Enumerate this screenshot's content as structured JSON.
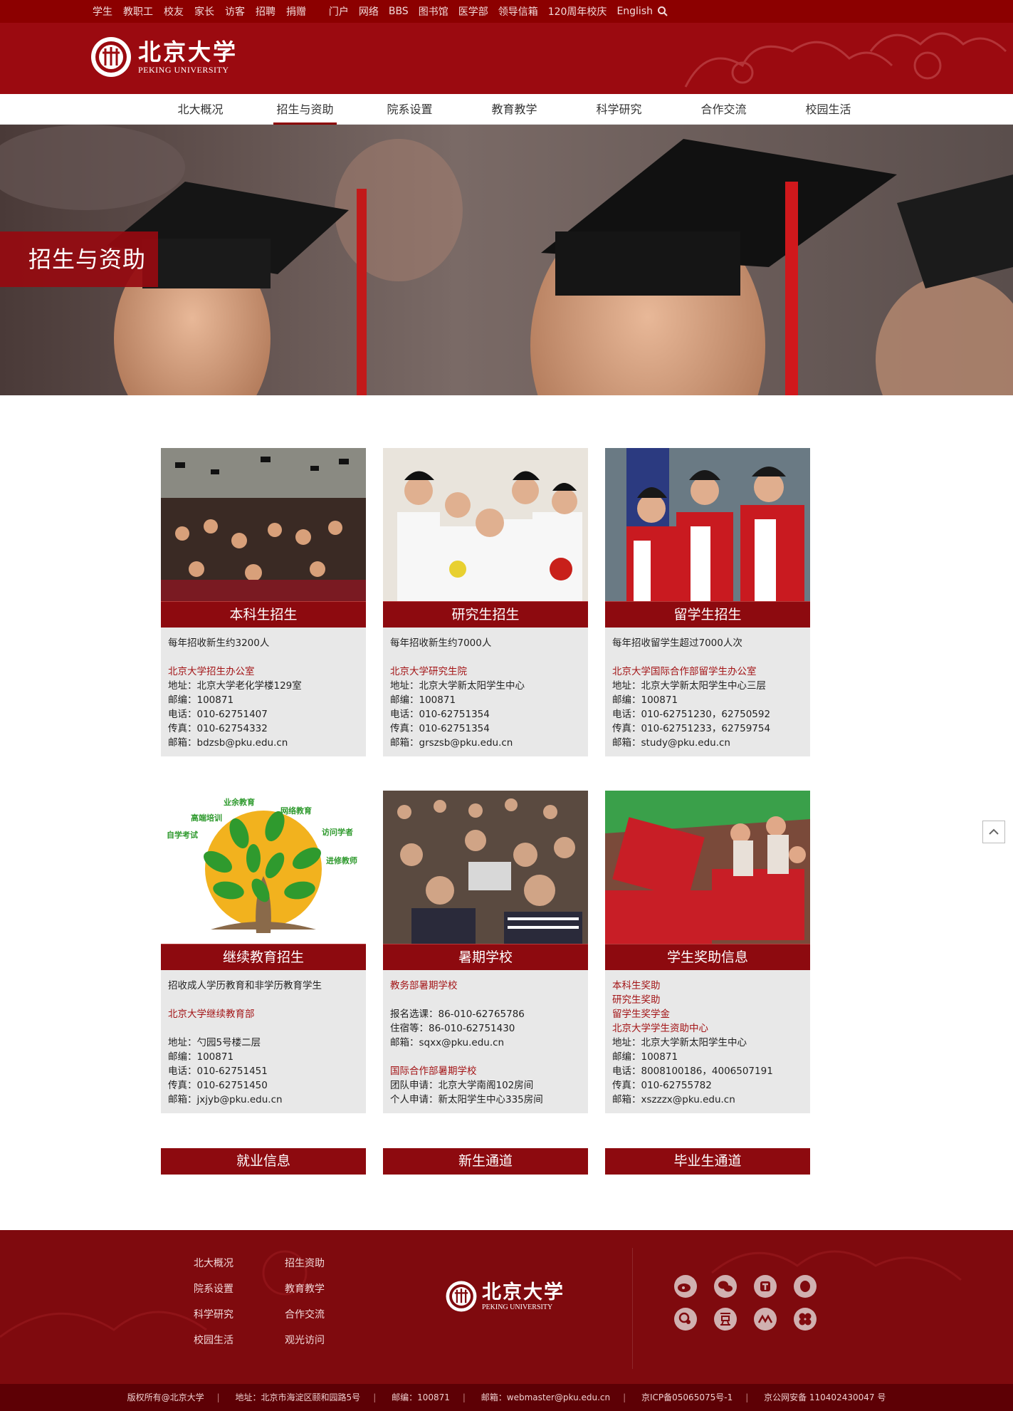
{
  "topbar": {
    "left_links": [
      "学生",
      "教职工",
      "校友",
      "家长",
      "访客",
      "招聘",
      "捐赠"
    ],
    "right_links": [
      "门户",
      "网络",
      "BBS",
      "图书馆",
      "医学部",
      "领导信箱",
      "120周年校庆",
      "English"
    ],
    "search_icon": "search-icon"
  },
  "header": {
    "logo_cn": "北京大学",
    "logo_en": "PEKING UNIVERSITY",
    "seal_icon": "pku-seal-icon"
  },
  "nav": {
    "items": [
      "北大概况",
      "招生与资助",
      "院系设置",
      "教育教学",
      "科学研究",
      "合作交流",
      "校园生活"
    ],
    "active": "招生与资助"
  },
  "banner": {
    "title": "招生与资助"
  },
  "cards": [
    {
      "title": "本科生招生",
      "summary": "每年招收新生约3200人",
      "office": "北京大学招生办公室",
      "address": "地址：北京大学老化学楼129室",
      "postcode": "邮编：100871",
      "phone": "电话：010-62751407",
      "fax": "传真：010-62754332",
      "email": "邮箱：bdzsb@pku.edu.cn"
    },
    {
      "title": "研究生招生",
      "summary": "每年招收新生约7000人",
      "office": "北京大学研究生院",
      "address": "地址：北京大学新太阳学生中心",
      "postcode": "邮编：100871",
      "phone": "电话：010-62751354",
      "fax": "传真：010-62751354",
      "email": "邮箱：grszsb@pku.edu.cn"
    },
    {
      "title": "留学生招生",
      "summary": "每年招收留学生超过7000人次",
      "office": "北京大学国际合作部留学生办公室",
      "address": "地址：北京大学新太阳学生中心三层",
      "postcode": "邮编：100871",
      "phone": "电话：010-62751230，62750592",
      "fax": "传真：010-62751233，62759754",
      "email": "邮箱：study@pku.edu.cn"
    },
    {
      "title": "继续教育招生",
      "summary": "招收成人学历教育和非学历教育学生",
      "office": "北京大学继续教育部",
      "address": "地址：勺园5号楼二层",
      "postcode": "邮编：100871",
      "phone": "电话：010-62751451",
      "fax": "传真：010-62751450",
      "email": "邮箱：jxjyb@pku.edu.cn",
      "tree_words": [
        "业余教育",
        "网络教育",
        "高端培训",
        "访问学者",
        "自学考试",
        "进修教师"
      ]
    },
    {
      "title": "暑期学校",
      "office": "教务部暑期学校",
      "line1": "报名选课：86-010-62765786",
      "line2": "住宿等：86-010-62751430",
      "email": "邮箱：sqxx@pku.edu.cn",
      "office2": "国际合作部暑期学校",
      "line3": "团队申请：北京大学南阁102房间",
      "line4": "个人申请：新太阳学生中心335房间"
    },
    {
      "title": "学生奖助信息",
      "link1": "本科生奖助",
      "link2": "研究生奖助",
      "link3": "留学生奖学金",
      "office": "北京大学学生资助中心",
      "address": "地址：北京大学新太阳学生中心",
      "postcode": "邮编：100871",
      "phone": "电话：8008100186，4006507191",
      "fax": "传真：010-62755782",
      "email": "邮箱：xszzzx@pku.edu.cn"
    }
  ],
  "bottom_buttons": [
    "就业信息",
    "新生通道",
    "毕业生通道"
  ],
  "footer": {
    "links": [
      "北大概况",
      "招生资助",
      "院系设置",
      "教育教学",
      "科学研究",
      "合作交流",
      "校园生活",
      "观光访问"
    ],
    "logo_cn": "北京大学",
    "logo_en": "PEKING UNIVERSITY",
    "social_icons": [
      "weibo-icon",
      "wechat-icon",
      "tencent-weibo-icon",
      "qq-icon",
      "renren-icon",
      "douban-icon",
      "kaixin-icon",
      "clover-icon"
    ]
  },
  "copyright": {
    "owner": "版权所有@北京大学",
    "address": "地址：北京市海淀区颐和园路5号",
    "postcode": "邮编：100871",
    "email": "邮箱：webmaster@pku.edu.cn",
    "icp": "京ICP备05065075号-1",
    "police": "京公网安备 110402430047 号"
  },
  "colors": {
    "brand": "#8c0000",
    "card_bg": "#e8e8e8",
    "link_red": "#a31416"
  }
}
